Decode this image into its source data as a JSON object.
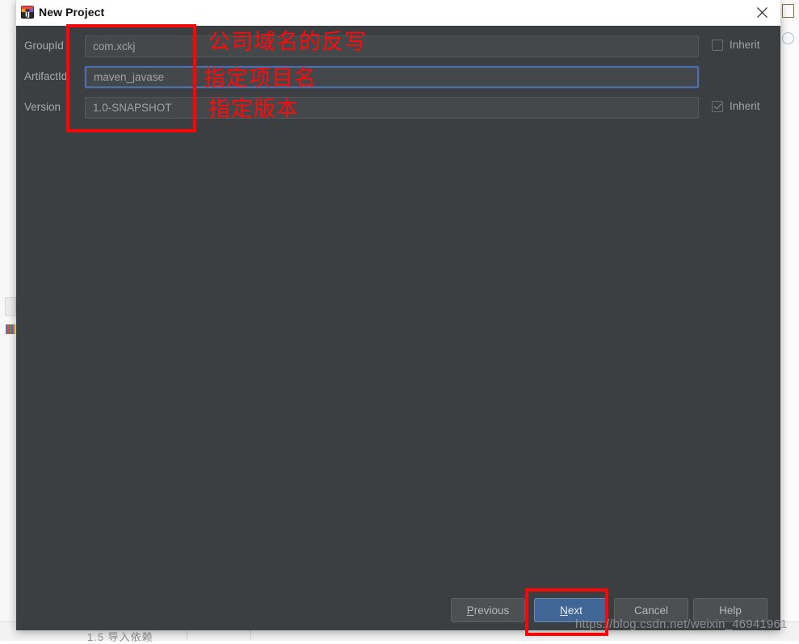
{
  "window": {
    "title": "New Project",
    "app_icon": "intellij-idea-icon",
    "close_icon": "close-icon"
  },
  "form": {
    "rows": [
      {
        "label": "GroupId",
        "value": "com.xckj",
        "placeholder": "GroupId",
        "focused": false,
        "inherit": {
          "label": "Inherit",
          "checked": false,
          "visible": true
        }
      },
      {
        "label": "ArtifactId",
        "value": "maven_javase",
        "placeholder": "ArtifactId",
        "focused": true,
        "inherit": {
          "label": "",
          "checked": false,
          "visible": false
        }
      },
      {
        "label": "Version",
        "value": "1.0-SNAPSHOT",
        "placeholder": "Version",
        "focused": false,
        "inherit": {
          "label": "Inherit",
          "checked": true,
          "visible": true
        }
      }
    ]
  },
  "footer": {
    "previous": {
      "label": "Previous",
      "mnemonic": "P",
      "rest": "revious"
    },
    "next": {
      "label": "Next",
      "mnemonic": "N",
      "rest": "ext"
    },
    "cancel": {
      "label": "Cancel"
    },
    "help": {
      "label": "Help"
    }
  },
  "annotations": {
    "groupid_note": "公司域名的反写",
    "artifactid_note": "指定项目名",
    "version_note": "指定版本",
    "highlight_color": "#fb0606"
  },
  "watermark": {
    "text": "https://blog.csdn.net/weixin_46941961"
  },
  "background": {
    "bottom_text": "1.5  导入依赖"
  },
  "colors": {
    "dialog_background": "#3c3f41",
    "titlebar_background": "#ffffff",
    "field_background": "#45484a",
    "accent_blue": "#3f6694",
    "focus_border": "#4b6eaf",
    "label_text": "#a7aaab"
  }
}
